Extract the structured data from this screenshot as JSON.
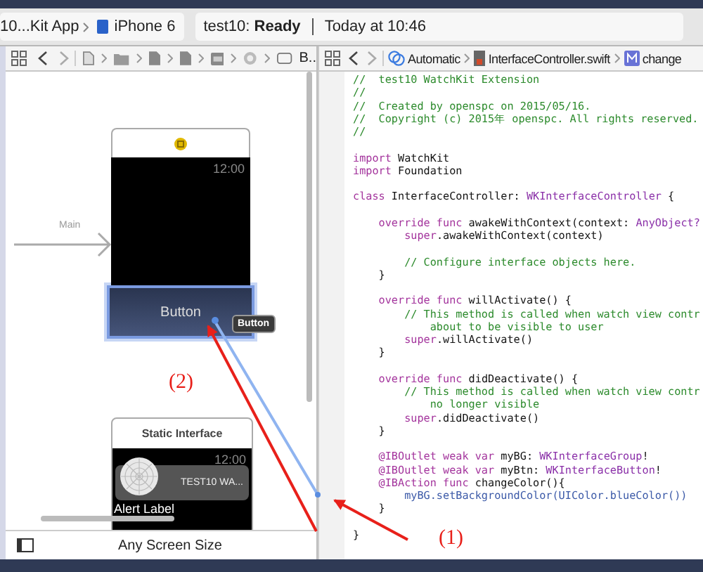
{
  "toolbar": {
    "scheme": "10...Kit App",
    "device": "iPhone 6",
    "status": "test10: **Ready**",
    "time": "Today at 10:46"
  },
  "left_jump_bar": {
    "last": "B.."
  },
  "right_jump_bar": {
    "items": [
      {
        "kind": "auto",
        "label": "Automatic"
      },
      {
        "kind": "file",
        "label": "InterfaceController.swift"
      },
      {
        "kind": "method",
        "label": "change"
      }
    ]
  },
  "canvas": {
    "entry_label": "Main",
    "watch_time": "12:00",
    "button_label": "Button",
    "tooltip": "Button",
    "button_selected": true,
    "static": {
      "title": "Static Interface",
      "time": "12:00",
      "app_name": "TEST10 WA...",
      "alert": "Alert Label"
    },
    "bottom_label": "Any Screen Size"
  },
  "code": [
    {
      "parts": [
        {
          "kind": "comment",
          "text": "//  test10 WatchKit Extension"
        }
      ]
    },
    {
      "parts": [
        {
          "kind": "comment",
          "text": "//"
        }
      ]
    },
    {
      "parts": [
        {
          "kind": "comment",
          "text": "//  Created by openspc on 2015/05/16."
        }
      ]
    },
    {
      "parts": [
        {
          "kind": "comment",
          "text": "//  Copyright (c) 2015年 openspc. All rights reserved."
        }
      ]
    },
    {
      "parts": [
        {
          "kind": "comment",
          "text": "//"
        }
      ]
    },
    {
      "gap_before": true,
      "parts": [
        {
          "kind": "keyword",
          "text": "import"
        },
        {
          "kind": "plain",
          "text": " WatchKit"
        }
      ]
    },
    {
      "parts": [
        {
          "kind": "keyword",
          "text": "import"
        },
        {
          "kind": "plain",
          "text": " Foundation"
        }
      ]
    },
    {
      "gap_before": true,
      "parts": [
        {
          "kind": "keyword",
          "text": "class"
        },
        {
          "kind": "plain",
          "text": " InterfaceController: "
        },
        {
          "kind": "type",
          "text": "WKInterfaceController"
        },
        {
          "kind": "plain",
          "text": " {"
        }
      ]
    },
    {
      "gap_before": true,
      "parts": [
        {
          "kind": "keyword",
          "text": "    override func"
        },
        {
          "kind": "plain",
          "text": " awakeWithContext(context: "
        },
        {
          "kind": "type",
          "text": "AnyObject?"
        }
      ]
    },
    {
      "parts": [
        {
          "kind": "keyword",
          "text": "        super"
        },
        {
          "kind": "plain",
          "text": ".awakeWithContext(context)"
        }
      ]
    },
    {
      "gap_before": true,
      "parts": [
        {
          "kind": "comment",
          "text": "        // Configure interface objects here."
        }
      ]
    },
    {
      "parts": [
        {
          "kind": "plain",
          "text": "    }"
        }
      ]
    },
    {
      "gap_before": true,
      "parts": [
        {
          "kind": "keyword",
          "text": "    override func"
        },
        {
          "kind": "plain",
          "text": " willActivate() {"
        }
      ]
    },
    {
      "parts": [
        {
          "kind": "comment",
          "text": "        // This method is called when watch view contr"
        }
      ]
    },
    {
      "parts": [
        {
          "kind": "comment",
          "text": "            about to be visible to user"
        }
      ]
    },
    {
      "parts": [
        {
          "kind": "keyword",
          "text": "        super"
        },
        {
          "kind": "plain",
          "text": ".willActivate()"
        }
      ]
    },
    {
      "parts": [
        {
          "kind": "plain",
          "text": "    }"
        }
      ]
    },
    {
      "gap_before": true,
      "parts": [
        {
          "kind": "keyword",
          "text": "    override func"
        },
        {
          "kind": "plain",
          "text": " didDeactivate() {"
        }
      ]
    },
    {
      "parts": [
        {
          "kind": "comment",
          "text": "        // This method is called when watch view contr"
        }
      ]
    },
    {
      "parts": [
        {
          "kind": "comment",
          "text": "            no longer visible"
        }
      ]
    },
    {
      "parts": [
        {
          "kind": "keyword",
          "text": "        super"
        },
        {
          "kind": "plain",
          "text": ".didDeactivate()"
        }
      ]
    },
    {
      "parts": [
        {
          "kind": "plain",
          "text": "    }"
        }
      ]
    },
    {
      "gap_before": true,
      "parts": [
        {
          "kind": "keyword",
          "text": "    @IBOutlet weak var"
        },
        {
          "kind": "plain",
          "text": " myBG: "
        },
        {
          "kind": "type",
          "text": "WKInterfaceGroup"
        },
        {
          "kind": "plain",
          "text": "!"
        }
      ]
    },
    {
      "parts": [
        {
          "kind": "keyword",
          "text": "    @IBOutlet weak var"
        },
        {
          "kind": "plain",
          "text": " myBtn: "
        },
        {
          "kind": "type",
          "text": "WKInterfaceButton"
        },
        {
          "kind": "plain",
          "text": "!"
        }
      ]
    },
    {
      "parts": [
        {
          "kind": "keyword",
          "text": "    @IBAction func"
        },
        {
          "kind": "plain",
          "text": " changeColor(){"
        }
      ]
    },
    {
      "parts": [
        {
          "kind": "call",
          "text": "        myBG.setBackgroundColor(UIColor.blueColor())"
        }
      ]
    },
    {
      "parts": [
        {
          "kind": "plain",
          "text": "    }"
        }
      ]
    },
    {
      "gap_before": true,
      "parts": [
        {
          "kind": "plain",
          "text": "}"
        }
      ]
    }
  ],
  "annotations": [
    {
      "label": "(1)"
    },
    {
      "label": "(2)"
    }
  ]
}
